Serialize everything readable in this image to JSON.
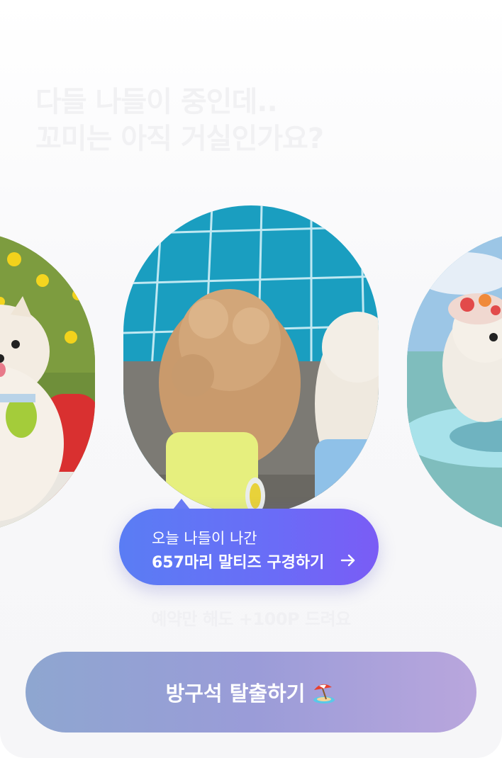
{
  "headline": {
    "line1": "다들 나들이 중인데..",
    "line2": "꼬미는 아직 거실인가요?"
  },
  "photos": {
    "left_icon": "pomeranian-photo",
    "center_icon": "poodles-by-pool-photo",
    "right_icon": "maltese-in-sea-photo"
  },
  "bubble": {
    "line1": "오늘 나들이 나간",
    "line2": "657마리 말티즈 구경하기",
    "arrow_icon": "arrow-right-icon"
  },
  "hint": "예약만 해도 +100P 드려요",
  "cta": {
    "label": "방구석 탈출하기",
    "emoji_icon": "beach-umbrella-icon"
  },
  "colors": {
    "bubble_start": "#5a7df4",
    "bubble_end": "#7a5cf5",
    "cta_start": "#8ea6d0",
    "cta_end": "#b9a6dd"
  }
}
